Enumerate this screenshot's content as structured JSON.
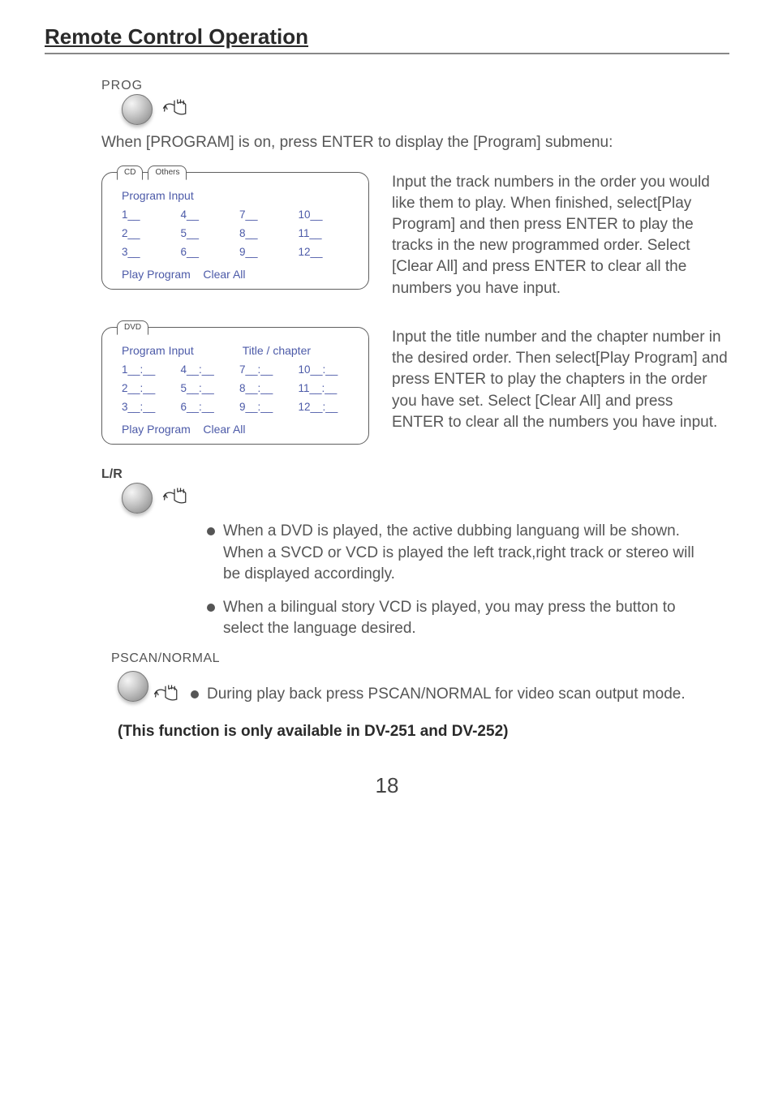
{
  "title": "Remote Control Operation",
  "prog": {
    "label": "PROG",
    "intro": "When [PROGRAM] is on, press ENTER to display the [Program] submenu:"
  },
  "cd_box": {
    "tabs": [
      "CD",
      "Others"
    ],
    "head": "Program Input",
    "cells": [
      "1__",
      "4__",
      "7__",
      "10__",
      "2__",
      "5__",
      "8__",
      "11__",
      "3__",
      "6__",
      "9__",
      "12__"
    ],
    "foot_play": "Play Program",
    "foot_clear": "Clear All"
  },
  "cd_desc": "Input the track numbers in the order you would like them to play. When finished, select[Play Program] and then press ENTER to play the tracks in the new programmed order. Select [Clear All] and press ENTER to clear all the numbers you have input.",
  "dvd_box": {
    "tabs": [
      "DVD"
    ],
    "head1": "Program Input",
    "head2": "Title / chapter",
    "cells": [
      "1__:__",
      "4__:__",
      "7__:__",
      "10__:__",
      "2__:__",
      "5__:__",
      "8__:__",
      "11__:__",
      "3__:__",
      "6__:__",
      "9__:__",
      "12__:__"
    ],
    "foot_play": "Play Program",
    "foot_clear": "Clear All"
  },
  "dvd_desc": "Input the title number and the chapter number in the desired order. Then select[Play Program] and press ENTER to play the chapters in the order you have set. Select [Clear All] and press ENTER to clear all the numbers you have input.",
  "lr": {
    "label": "L/R"
  },
  "lr_bullets": [
    "When a  DVD is played, the active dubbing languang will be shown. When a SVCD or VCD is played the left track,right track or stereo will be displayed accordingly.",
    "When a bilingual story VCD is played, you may press the button to select the language desired."
  ],
  "pscan": {
    "label": "PSCAN/NORMAL",
    "text": "During play back press PSCAN/NORMAL for video scan output mode."
  },
  "note": "(This function is only available in DV-251 and DV-252)",
  "page_number": "18"
}
